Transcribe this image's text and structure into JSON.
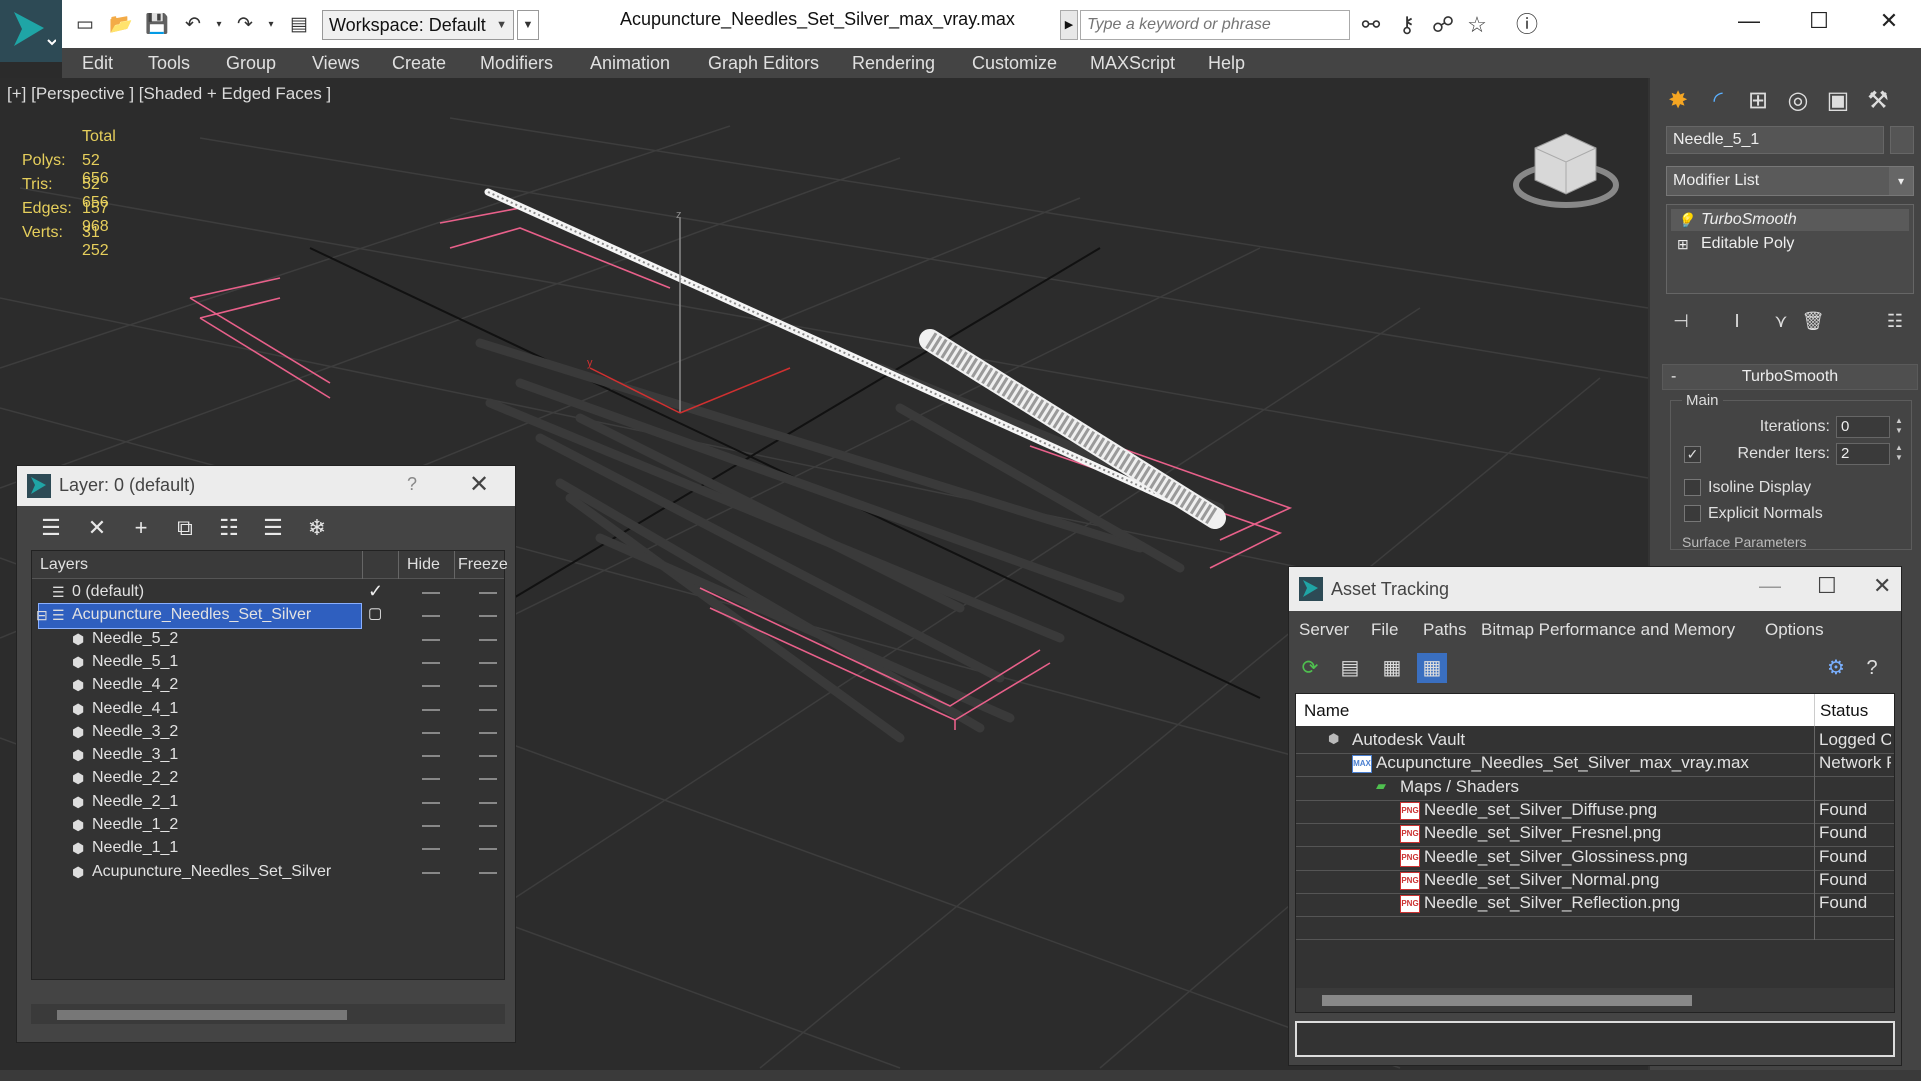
{
  "titlebar": {
    "workspace_label": "Workspace: Default",
    "doc_title": "Acupuncture_Needles_Set_Silver_max_vray.max",
    "search_placeholder": "Type a keyword or phrase"
  },
  "menu": [
    "Edit",
    "Tools",
    "Group",
    "Views",
    "Create",
    "Modifiers",
    "Animation",
    "Graph Editors",
    "Rendering",
    "Customize",
    "MAXScript",
    "Help"
  ],
  "viewport": {
    "label": "[+] [Perspective ] [Shaded + Edged Faces ]",
    "stats_header": "Total",
    "stats": [
      {
        "key": "Polys:",
        "value": "52 656"
      },
      {
        "key": "Tris:",
        "value": "52 656"
      },
      {
        "key": "Edges:",
        "value": "157 968"
      },
      {
        "key": "Verts:",
        "value": "31 252"
      }
    ],
    "axis_z_label": "z",
    "axis_y_label": "y"
  },
  "command_panel": {
    "object_name": "Needle_5_1",
    "modifier_list_label": "Modifier List",
    "stack": [
      "TurboSmooth",
      "Editable Poly"
    ],
    "rollout_title": "TurboSmooth",
    "group_main": "Main",
    "iterations_label": "Iterations:",
    "iterations_value": "0",
    "render_iters_label": "Render Iters:",
    "render_iters_value": "2",
    "render_iters_checked": true,
    "isoline_label": "Isoline Display",
    "explicit_normals_label": "Explicit Normals",
    "surface_params_label": "Surface Parameters"
  },
  "layer_dialog": {
    "title": "Layer: 0 (default)",
    "help": "?",
    "col_layers": "Layers",
    "col_hide": "Hide",
    "col_freeze": "Freeze",
    "rows": [
      {
        "name": "0 (default)",
        "level": 0,
        "type": "layer",
        "current": true
      },
      {
        "name": "Acupuncture_Needles_Set_Silver",
        "level": 0,
        "type": "layer",
        "selected": true
      },
      {
        "name": "Needle_5_2",
        "level": 1,
        "type": "object"
      },
      {
        "name": "Needle_5_1",
        "level": 1,
        "type": "object"
      },
      {
        "name": "Needle_4_2",
        "level": 1,
        "type": "object"
      },
      {
        "name": "Needle_4_1",
        "level": 1,
        "type": "object"
      },
      {
        "name": "Needle_3_2",
        "level": 1,
        "type": "object"
      },
      {
        "name": "Needle_3_1",
        "level": 1,
        "type": "object"
      },
      {
        "name": "Needle_2_2",
        "level": 1,
        "type": "object"
      },
      {
        "name": "Needle_2_1",
        "level": 1,
        "type": "object"
      },
      {
        "name": "Needle_1_2",
        "level": 1,
        "type": "object"
      },
      {
        "name": "Needle_1_1",
        "level": 1,
        "type": "object"
      },
      {
        "name": "Acupuncture_Needles_Set_Silver",
        "level": 1,
        "type": "object"
      }
    ]
  },
  "asset_dialog": {
    "title": "Asset Tracking",
    "menu": [
      "Server",
      "File",
      "Paths",
      "Bitmap Performance and Memory",
      "Options"
    ],
    "col_name": "Name",
    "col_status": "Status",
    "rows": [
      {
        "name": "Autodesk Vault",
        "status": "Logged Ou",
        "level": 1,
        "icon": "vault"
      },
      {
        "name": "Acupuncture_Needles_Set_Silver_max_vray.max",
        "status": "Network Pa",
        "level": 2,
        "icon": "max"
      },
      {
        "name": "Maps / Shaders",
        "status": "",
        "level": 3,
        "icon": "maps"
      },
      {
        "name": "Needle_set_Silver_Diffuse.png",
        "status": "Found",
        "level": 4,
        "icon": "png"
      },
      {
        "name": "Needle_set_Silver_Fresnel.png",
        "status": "Found",
        "level": 4,
        "icon": "png"
      },
      {
        "name": "Needle_set_Silver_Glossiness.png",
        "status": "Found",
        "level": 4,
        "icon": "png"
      },
      {
        "name": "Needle_set_Silver_Normal.png",
        "status": "Found",
        "level": 4,
        "icon": "png"
      },
      {
        "name": "Needle_set_Silver_Reflection.png",
        "status": "Found",
        "level": 4,
        "icon": "png"
      }
    ]
  },
  "colors": {
    "stats_yellow": "#e6cf5c",
    "selection_blue": "#2f5fbf",
    "bbox_pink": "#e8608a",
    "viewport_bg": "#2c2c2c",
    "panel_bg": "#444444"
  }
}
